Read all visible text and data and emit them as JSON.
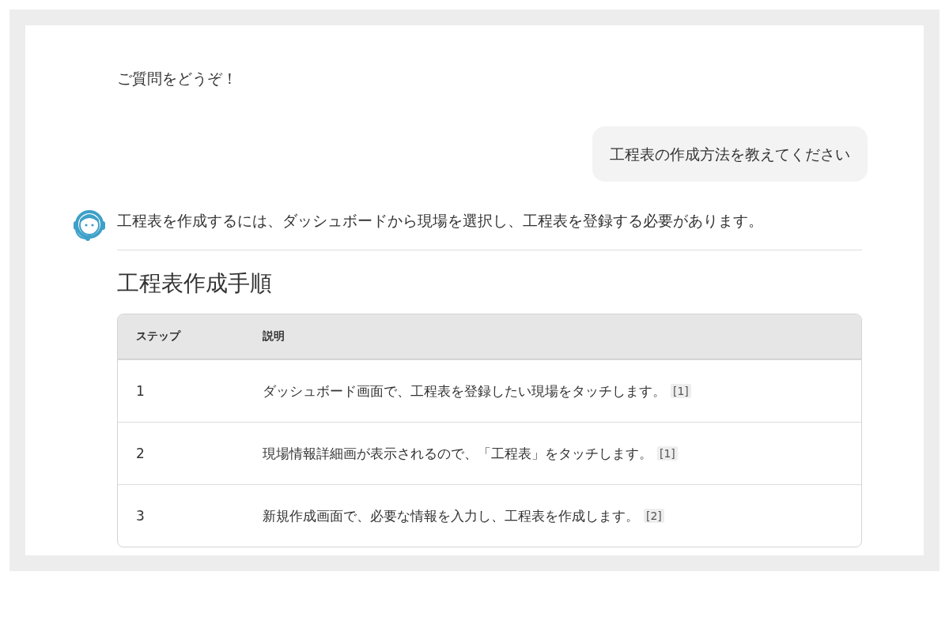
{
  "greeting": "ご質問をどうぞ！",
  "user_message": "工程表の作成方法を教えてください",
  "answer": {
    "text": "工程表を作成するには、ダッシュボードから現場を選択し、工程表を登録する必要があります。",
    "heading": "工程表作成手順",
    "table": {
      "columns": [
        "ステップ",
        "説明"
      ],
      "rows": [
        {
          "step": "1",
          "description": "ダッシュボード画面で、工程表を登録したい現場をタッチします。",
          "citation": "[1]"
        },
        {
          "step": "2",
          "description": "現場情報詳細画が表示されるので、「工程表」をタッチします。",
          "citation": "[1]"
        },
        {
          "step": "3",
          "description": "新規作成画面で、必要な情報を入力し、工程表を作成します。",
          "citation": "[2]"
        }
      ]
    }
  }
}
